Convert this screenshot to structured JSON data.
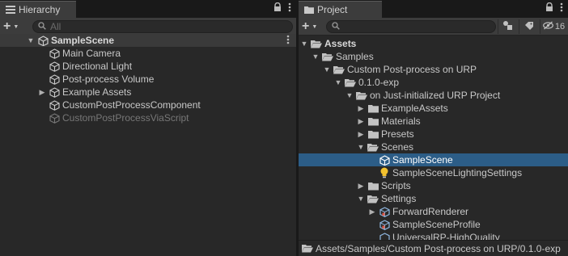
{
  "hierarchy": {
    "tab_label": "Hierarchy",
    "search_placeholder": "All",
    "scene": "SampleScene",
    "items": [
      {
        "label": "Main Camera"
      },
      {
        "label": "Directional Light"
      },
      {
        "label": "Post-process Volume"
      },
      {
        "label": "Example Assets"
      },
      {
        "label": "CustomPostProcessComponent"
      },
      {
        "label": "CustomPostProcessViaScript"
      }
    ]
  },
  "project": {
    "tab_label": "Project",
    "hidden_count": "16",
    "tree": [
      {
        "label": "Assets"
      },
      {
        "label": "Samples"
      },
      {
        "label": "Custom Post-process on URP"
      },
      {
        "label": "0.1.0-exp"
      },
      {
        "label": "on Just-initialized URP Project"
      },
      {
        "label": "ExampleAssets"
      },
      {
        "label": "Materials"
      },
      {
        "label": "Presets"
      },
      {
        "label": "Scenes"
      },
      {
        "label": "SampleScene"
      },
      {
        "label": "SampleSceneLightingSettings"
      },
      {
        "label": "Scripts"
      },
      {
        "label": "Settings"
      },
      {
        "label": "ForwardRenderer"
      },
      {
        "label": "SampleSceneProfile"
      },
      {
        "label": "UniversalRP-HighQuality"
      }
    ],
    "path": "Assets/Samples/Custom Post-process on URP/0.1.0-exp"
  },
  "colors": {
    "selection": "#2c5d87",
    "panel_bg": "#282828",
    "toolbar_bg": "#3c3c3c"
  }
}
